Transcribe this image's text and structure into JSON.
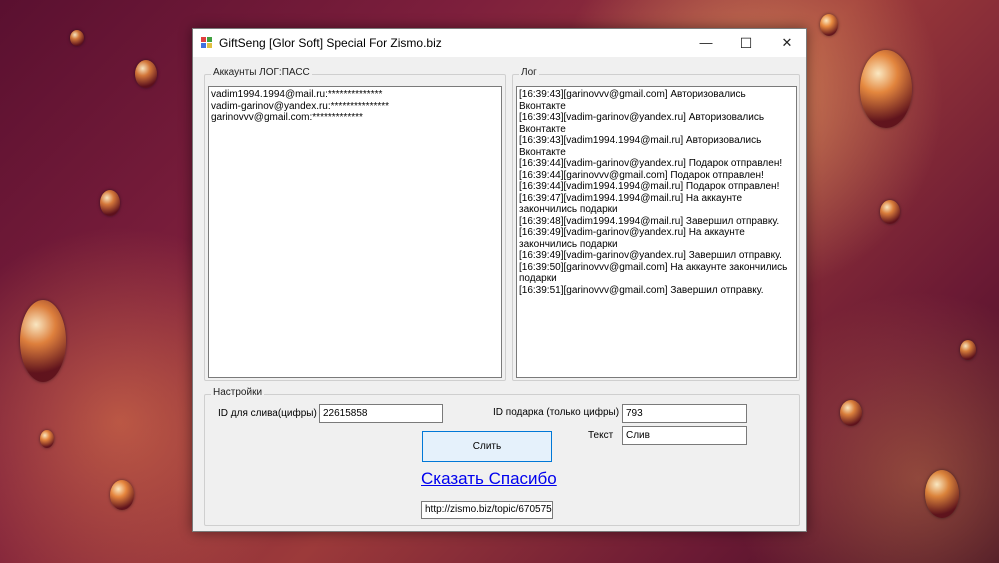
{
  "window": {
    "title": "GiftSeng  [Glor Soft] Special For Zismo.biz",
    "controls": {
      "minimize": "—",
      "maximize": "☐",
      "close": "✕"
    }
  },
  "accounts": {
    "title": "Аккаунты ЛОГ:ПАСС",
    "lines": [
      "vadim1994.1994@mail.ru:**************",
      "vadim-garinov@yandex.ru:***************",
      "garinovvv@gmail.com:*************"
    ]
  },
  "log": {
    "title": "Лог",
    "lines": [
      "[16:39:43][garinovvv@gmail.com] Авторизовались Вконтакте",
      "[16:39:43][vadim-garinov@yandex.ru] Авторизовались Вконтакте",
      "[16:39:43][vadim1994.1994@mail.ru] Авторизовались Вконтакте",
      "[16:39:44][vadim-garinov@yandex.ru] Подарок отправлен!",
      "[16:39:44][garinovvv@gmail.com] Подарок отправлен!",
      "[16:39:44][vadim1994.1994@mail.ru] Подарок отправлен!",
      "[16:39:47][vadim1994.1994@mail.ru] На аккаунте закончились подарки",
      "[16:39:48][vadim1994.1994@mail.ru] Завершил отправку.",
      "[16:39:49][vadim-garinov@yandex.ru] На аккаунте закончились подарки",
      "[16:39:49][vadim-garinov@yandex.ru] Завершил отправку.",
      "[16:39:50][garinovvv@gmail.com] На аккаунте закончились подарки",
      "[16:39:51][garinovvv@gmail.com] Завершил отправку."
    ]
  },
  "settings": {
    "title": "Настройки",
    "drain_id_label": "ID для слива(цифры)",
    "drain_id_value": "22615858",
    "gift_id_label": "ID подарка (только цифры)",
    "gift_id_value": "793",
    "text_label": "Текст",
    "text_value": "Слив",
    "submit_label": "Слить",
    "thanks_link": "Сказать Спасибо",
    "url_value": "http://zismo.biz/topic/670575"
  }
}
